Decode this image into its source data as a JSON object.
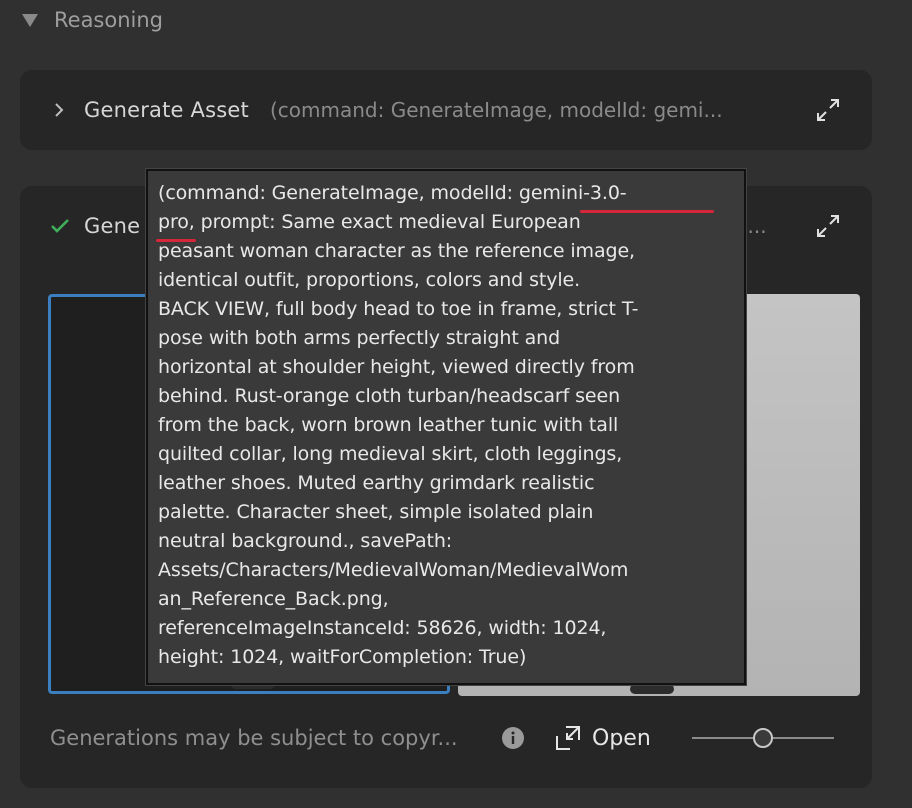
{
  "reasoning": {
    "label": "Reasoning"
  },
  "cards": [
    {
      "title": "Generate Asset",
      "params": "(command: GenerateImage, modelId: gemi..."
    },
    {
      "title": "Gene",
      "params": "i..."
    }
  ],
  "footer": {
    "disclaimer": "Generations may be subject to copyr...",
    "open_label": "Open",
    "slider_value": 0.5
  },
  "tooltip": {
    "lines": [
      "(command: GenerateImage, modelId: gemini-3.0-",
      "pro, prompt: Same exact medieval European",
      "peasant woman character as the reference image,",
      "identical outfit, proportions, colors and style.",
      "BACK VIEW, full body head to toe in frame, strict T-",
      "pose with both arms perfectly straight and",
      "horizontal at shoulder height, viewed directly from",
      "behind. Rust-orange cloth turban/headscarf seen",
      "from the back, worn brown leather tunic with tall",
      "quilted collar, long medieval skirt, cloth leggings,",
      "leather shoes. Muted earthy grimdark realistic",
      "palette. Character sheet, simple isolated plain",
      "neutral background., savePath:",
      "Assets/Characters/MedievalWoman/MedievalWom",
      "an_Reference_Back.png,",
      "referenceImageInstanceId: 58626, width: 1024,",
      "height: 1024, waitForCompletion: True)"
    ]
  },
  "colors": {
    "accent_blue": "#3b7fc0",
    "success_green": "#3fae5a",
    "annotation_red": "#d6263a"
  }
}
